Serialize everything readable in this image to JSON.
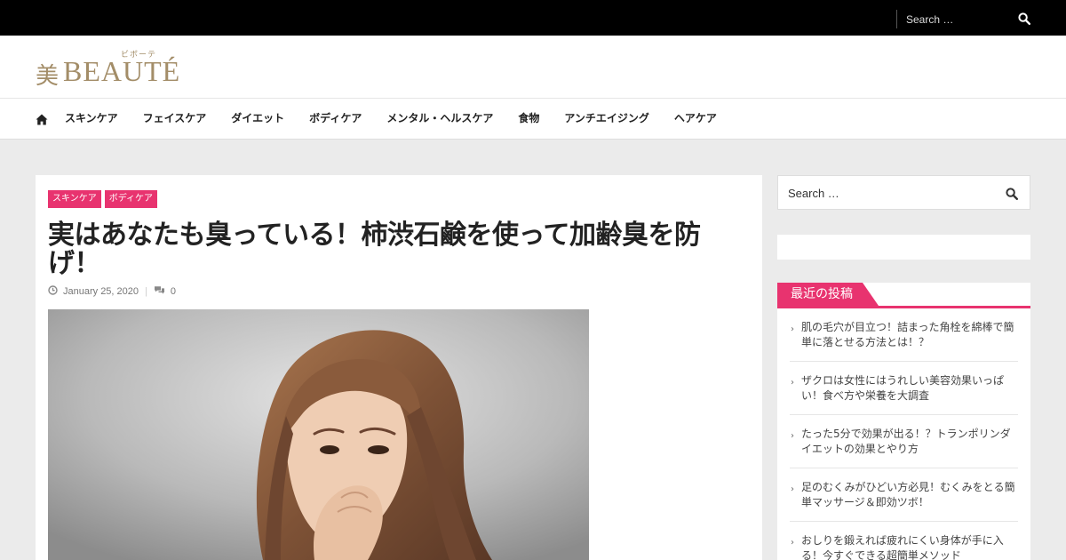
{
  "top_bar": {
    "search_placeholder": "Search …"
  },
  "header": {
    "logo": {
      "kanji": "美",
      "text": "BEAUTÉ",
      "ruby": "ビボーテ"
    }
  },
  "nav": {
    "items": [
      {
        "label": "スキンケア"
      },
      {
        "label": "フェイスケア"
      },
      {
        "label": "ダイエット"
      },
      {
        "label": "ボディケア"
      },
      {
        "label": "メンタル・ヘルスケア"
      },
      {
        "label": "食物"
      },
      {
        "label": "アンチエイジング"
      },
      {
        "label": "ヘアケア"
      }
    ]
  },
  "article": {
    "categories": [
      "スキンケア",
      "ボディケア"
    ],
    "title": "実はあなたも臭っている！柿渋石鹸を使って加齢臭を防げ！",
    "date": "January 25, 2020",
    "comments": "0"
  },
  "sidebar": {
    "search_placeholder": "Search …",
    "recent_title": "最近の投稿",
    "recent_posts": [
      {
        "title": "肌の毛穴が目立つ！詰まった角栓を綿棒で簡単に落とせる方法とは！？"
      },
      {
        "title": "ザクロは女性にはうれしい美容効果いっぱい！食べ方や栄養を大調査"
      },
      {
        "title": "たった5分で効果が出る！？トランポリンダイエットの効果とやり方"
      },
      {
        "title": "足のむくみがひどい方必見！むくみをとる簡単マッサージ＆即効ツボ！"
      },
      {
        "title": "おしりを鍛えれば疲れにくい身体が手に入る！今すぐできる超簡単メソッド"
      }
    ]
  },
  "colors": {
    "accent": "#e8336f",
    "logo": "#a38d68",
    "topbar": "#000000",
    "background": "#ebebeb"
  }
}
